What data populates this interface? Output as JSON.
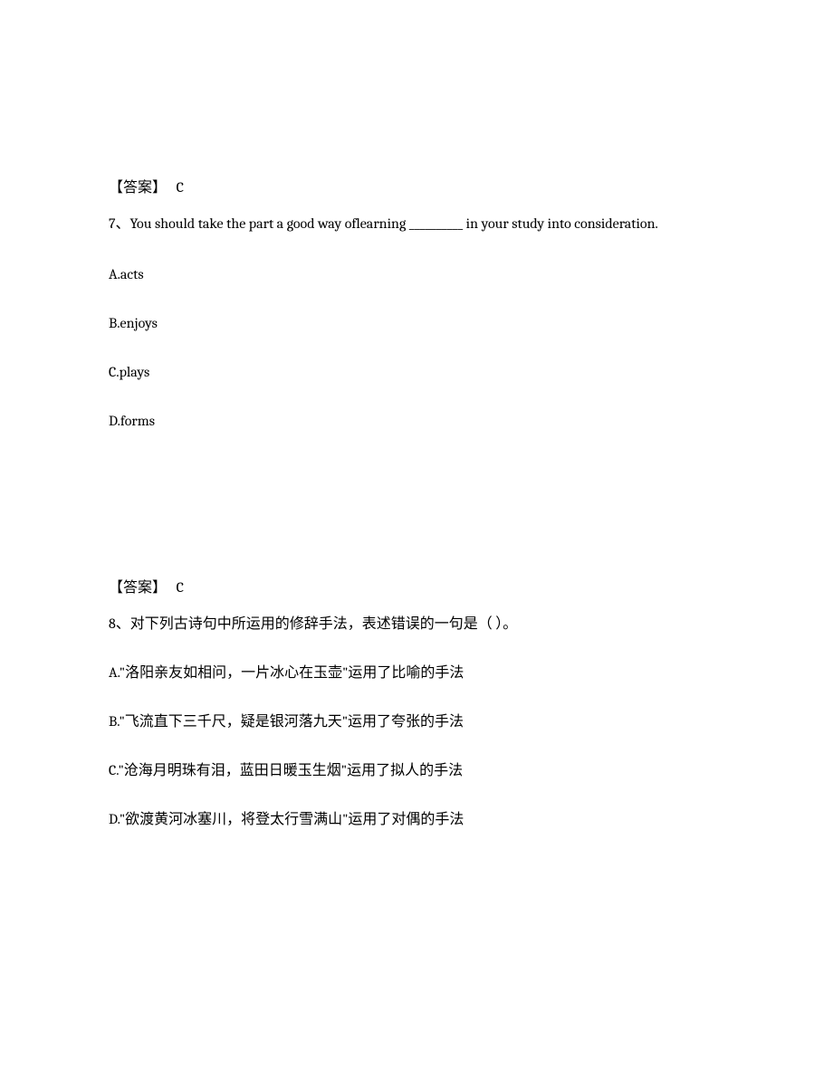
{
  "answer6": {
    "label": "【答案】",
    "value": "C"
  },
  "question7": {
    "number": "7、",
    "text": "You should take the part a good way oflearning __________ in your study into consideration.",
    "options": {
      "a": "A.acts",
      "b": "B.enjoys",
      "c": "C.plays",
      "d": "D.forms"
    }
  },
  "answer7": {
    "label": "【答案】",
    "value": "C"
  },
  "question8": {
    "number": "8、",
    "text": "对下列古诗句中所运用的修辞手法，表述错误的一句是（ ）。",
    "options": {
      "a": "A.\"洛阳亲友如相问，一片冰心在玉壶\"运用了比喻的手法",
      "b": "B.\"飞流直下三千尺，疑是银河落九天\"运用了夸张的手法",
      "c": "C.\"沧海月明珠有泪，蓝田日暖玉生烟\"运用了拟人的手法",
      "d": "D.\"欲渡黄河冰塞川，将登太行雪满山\"运用了对偶的手法"
    }
  }
}
